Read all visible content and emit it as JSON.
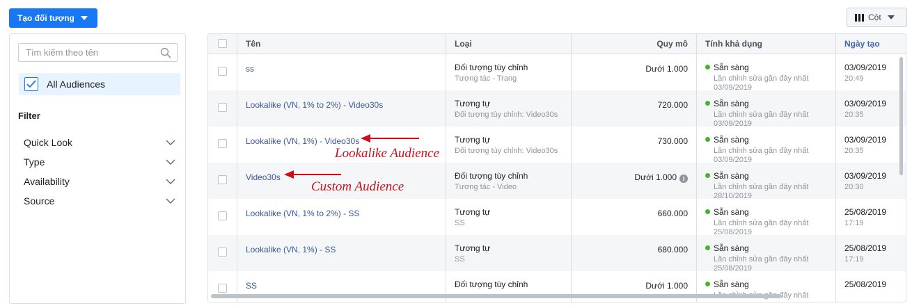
{
  "toolbar": {
    "create_label": "Tạo đối tượng",
    "columns_label": "Cột"
  },
  "sidebar": {
    "search_placeholder": "Tìm kiếm theo tên",
    "all_audiences": "All Audiences",
    "filter_title": "Filter",
    "filters": [
      "Quick Look",
      "Type",
      "Availability",
      "Source"
    ]
  },
  "table": {
    "headers": {
      "name": "Tên",
      "type": "Loại",
      "size": "Quy mô",
      "availability": "Tính khả dụng",
      "created": "Ngày tạo"
    },
    "rows": [
      {
        "name": "ss",
        "type": "Đối tượng tùy chỉnh",
        "subtype": "Tương tác - Trang",
        "size": "Dưới 1.000",
        "info": false,
        "status": "Sẵn sàng",
        "status_note": "Lần chỉnh sửa gần đây nhất",
        "status_date": "03/09/2019",
        "date": "03/09/2019",
        "time": "20:49"
      },
      {
        "name": "Lookalike (VN, 1% to 2%) - Video30s",
        "type": "Tương tự",
        "subtype": "Đối tượng tùy chỉnh: Video30s",
        "size": "720.000",
        "info": false,
        "status": "Sẵn sàng",
        "status_note": "Lần chỉnh sửa gần đây nhất",
        "status_date": "03/09/2019",
        "date": "03/09/2019",
        "time": "20:35"
      },
      {
        "name": "Lookalike (VN, 1%) - Video30s",
        "type": "Tương tự",
        "subtype": "Đối tượng tùy chỉnh: Video30s",
        "size": "730.000",
        "info": false,
        "status": "Sẵn sàng",
        "status_note": "Lần chỉnh sửa gần đây nhất",
        "status_date": "03/09/2019",
        "date": "03/09/2019",
        "time": "20:35"
      },
      {
        "name": "Video30s",
        "type": "Đối tượng tùy chỉnh",
        "subtype": "Tương tác - Video",
        "size": "Dưới 1.000",
        "info": true,
        "status": "Sẵn sàng",
        "status_note": "Lần chỉnh sửa gần đây nhất",
        "status_date": "28/10/2019",
        "date": "03/09/2019",
        "time": "20:30"
      },
      {
        "name": "Lookalike (VN, 1% to 2%) - SS",
        "type": "Tương tự",
        "subtype": "SS",
        "size": "660.000",
        "info": false,
        "status": "Sẵn sàng",
        "status_note": "Lần chỉnh sửa gần đây nhất",
        "status_date": "25/08/2019",
        "date": "25/08/2019",
        "time": "17:19"
      },
      {
        "name": "Lookalike (VN, 1%) - SS",
        "type": "Tương tự",
        "subtype": "SS",
        "size": "680.000",
        "info": false,
        "status": "Sẵn sàng",
        "status_note": "Lần chỉnh sửa gần đây nhất",
        "status_date": "25/08/2019",
        "date": "25/08/2019",
        "time": "17:19"
      },
      {
        "name": "SS",
        "type": "Đối tượng tùy chỉnh",
        "subtype": "",
        "size": "Dưới 1.000",
        "info": false,
        "status": "Sẵn sàng",
        "status_note": "Lần chỉnh sửa gần đây nhất",
        "status_date": "",
        "date": "25/08/2019",
        "time": ""
      }
    ]
  },
  "annotations": {
    "lookalike": "Lookalike Audience",
    "custom": "Custom Audience"
  },
  "colors": {
    "accent": "#1877f2",
    "link": "#385898",
    "status_ready": "#42b72a",
    "annotation": "#cc0e1d"
  }
}
